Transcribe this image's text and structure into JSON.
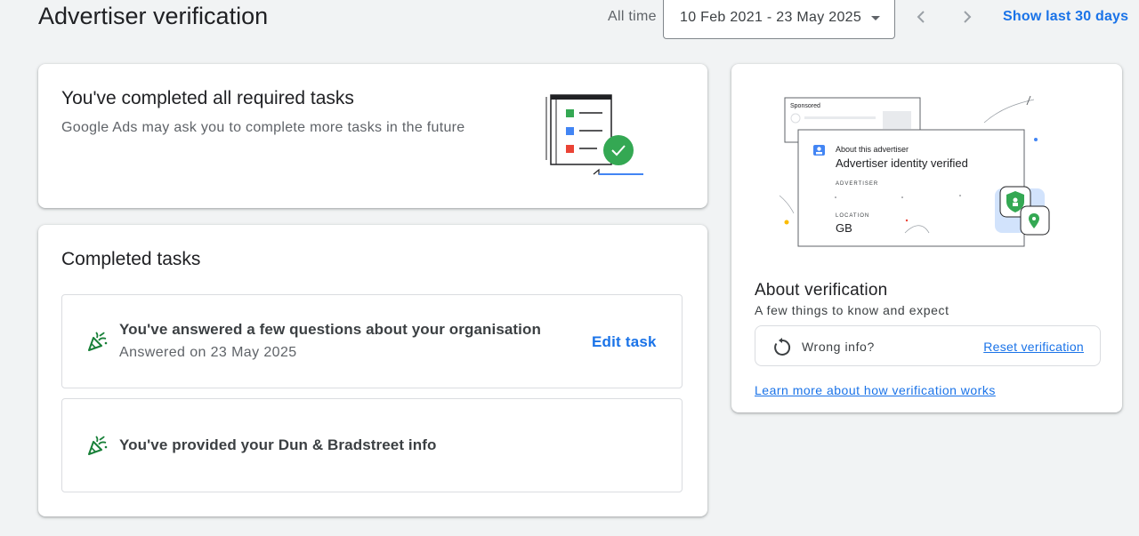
{
  "header": {
    "title": "Advertiser verification",
    "period_label": "All time",
    "date_range": "10 Feb 2021 - 23 May 2025",
    "show_last_30": "Show last 30 days"
  },
  "required_card": {
    "title": "You've completed all required tasks",
    "subtitle": "Google Ads may ask you to complete more tasks in the future",
    "colors": {
      "green": "#34a853",
      "blue": "#4285f4",
      "orange": "#ea4335"
    }
  },
  "completed_card": {
    "title": "Completed tasks",
    "tasks": [
      {
        "title": "You've answered a few questions about your organisation",
        "subtitle": "Answered on 23 May 2025",
        "action": "Edit task",
        "icon": "celebration-icon"
      },
      {
        "title": "You've provided your Dun & Bradstreet info",
        "icon": "celebration-icon"
      }
    ]
  },
  "about_card": {
    "illustration": {
      "sponsored": "Sponsored",
      "about_advertiser": "About this advertiser",
      "identity_verified": "Advertiser identity verified",
      "advertiser_label": "ADVERTISER",
      "location_label": "LOCATION",
      "location_value": "GB"
    },
    "title": "About verification",
    "subtitle": "A few things to know and expect",
    "wrong_info": "Wrong info?",
    "reset": "Reset verification",
    "learn_more": "Learn more about how verification works"
  },
  "colors": {
    "link": "#1a73e8",
    "icon_green": "#188038"
  }
}
